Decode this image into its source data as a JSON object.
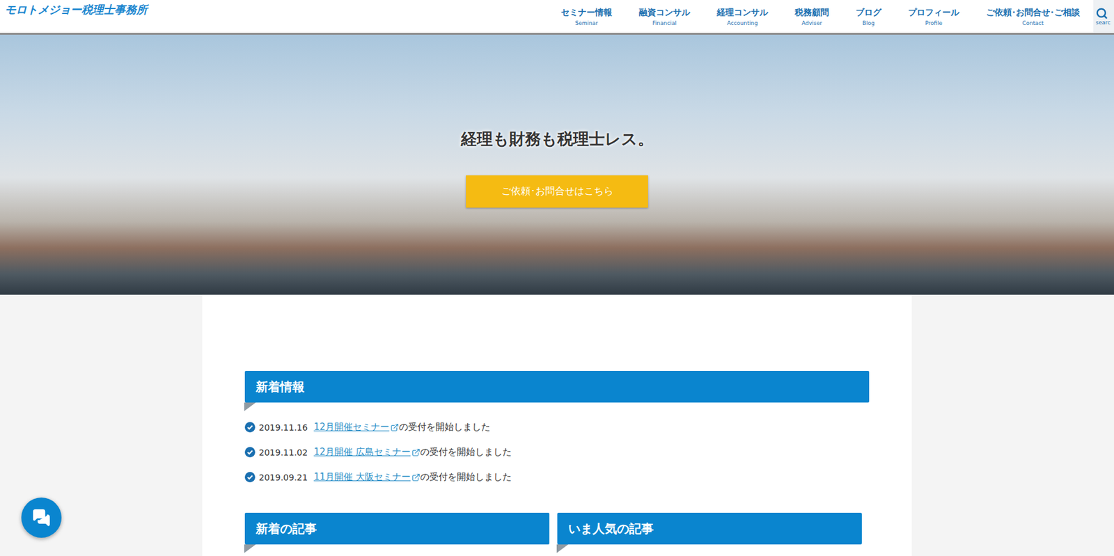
{
  "header": {
    "logo": "モロトメジョー税理士事務所",
    "nav": [
      {
        "label": "セミナー情報",
        "sub": "Seminar"
      },
      {
        "label": "融資コンサル",
        "sub": "Financial"
      },
      {
        "label": "経理コンサル",
        "sub": "Accounting"
      },
      {
        "label": "税務顧問",
        "sub": "Adviser"
      },
      {
        "label": "ブログ",
        "sub": "Blog"
      },
      {
        "label": "プロフィール",
        "sub": "Profile"
      },
      {
        "label": "ご依頼･お問合せ･ご相談",
        "sub": "Contact"
      }
    ],
    "search": "searc"
  },
  "hero": {
    "headline": "経理も財務も税理士レス。",
    "cta": "ご依頼･お問合せはこちら"
  },
  "news": {
    "title": "新着情報",
    "items": [
      {
        "date": "2019.11.16",
        "link": "12月開催セミナー",
        "text": "の受付を開始しました"
      },
      {
        "date": "2019.11.02",
        "link": "12月開催 広島セミナー",
        "text": "の受付を開始しました"
      },
      {
        "date": "2019.09.21",
        "link": "11月開催 大阪セミナー",
        "text": "の受付を開始しました"
      }
    ]
  },
  "columns": [
    {
      "title": "新着の記事"
    },
    {
      "title": "いま人気の記事"
    }
  ]
}
